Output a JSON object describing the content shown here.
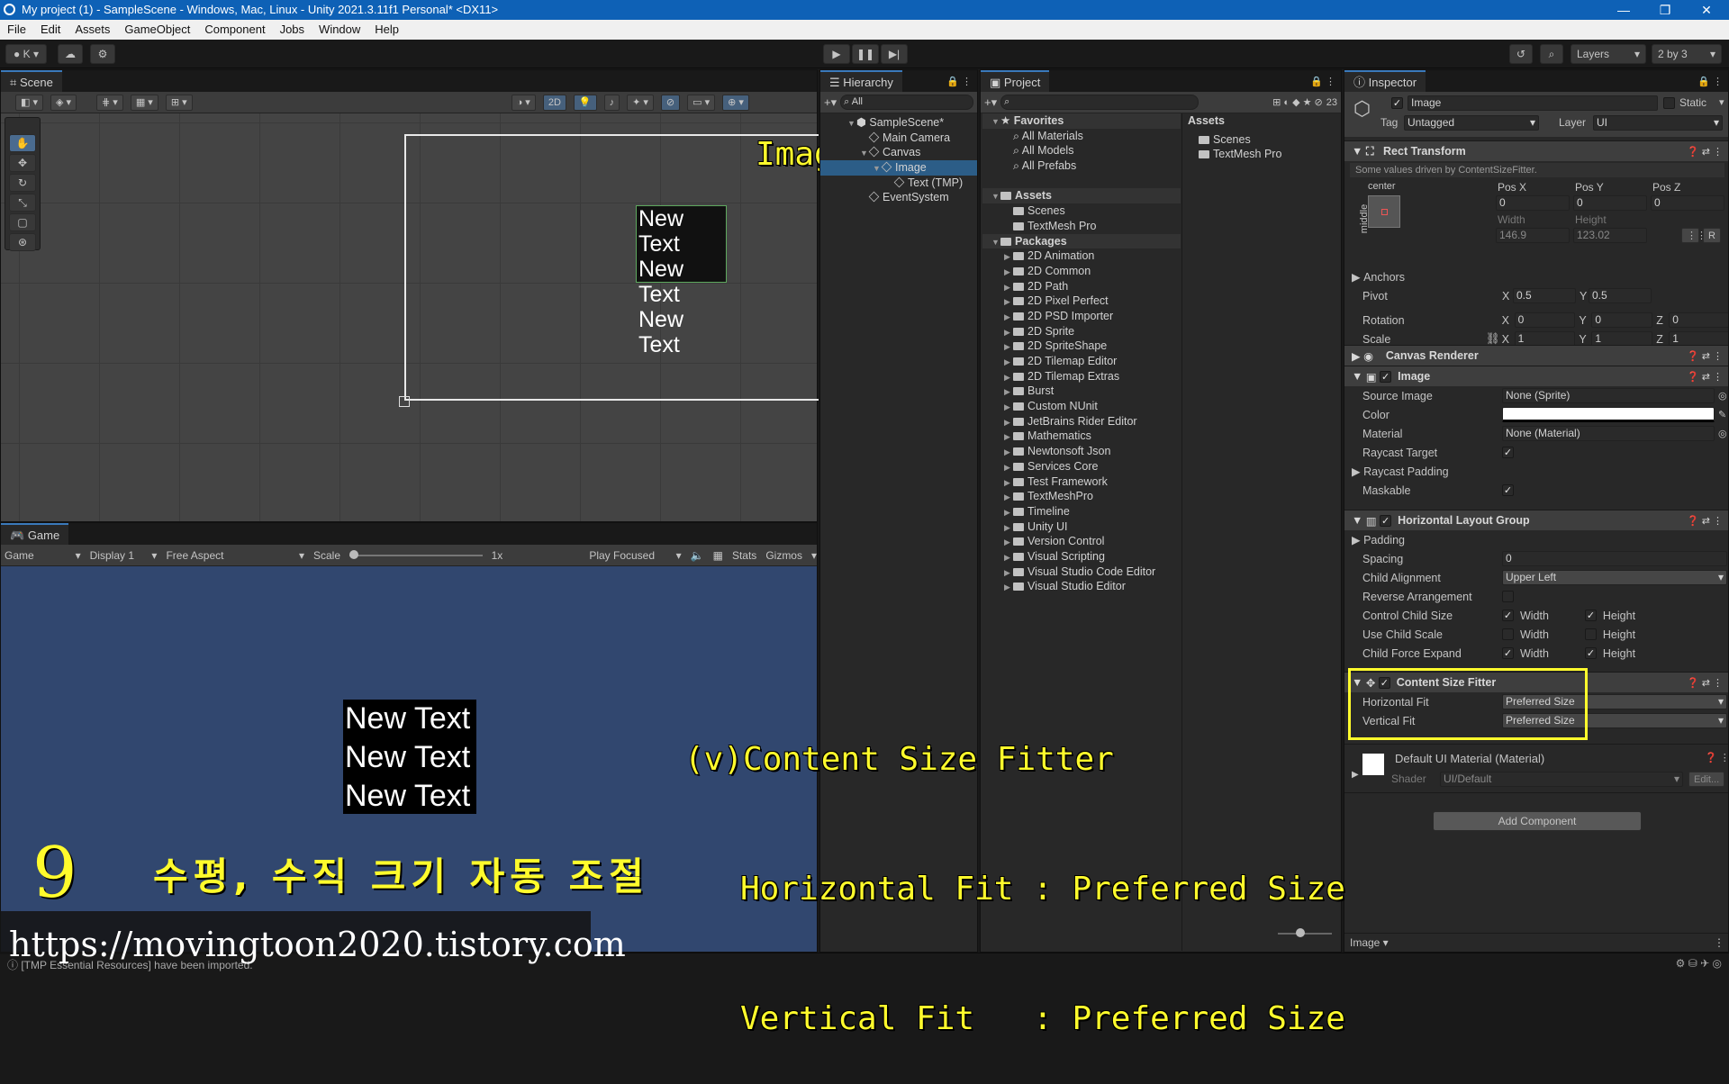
{
  "window": {
    "title": "My project (1) - SampleScene - Windows, Mac, Linux - Unity 2021.3.11f1 Personal* <DX11>",
    "min": "—",
    "max": "❐",
    "close": "✕"
  },
  "menu": [
    "File",
    "Edit",
    "Assets",
    "GameObject",
    "Component",
    "Jobs",
    "Window",
    "Help"
  ],
  "toolbar": {
    "account": "K",
    "layers": "Layers",
    "layout": "2 by 3"
  },
  "scene": {
    "tab": "Scene",
    "mode2d": "2D",
    "overlay_label": "Image",
    "texts": [
      "New Text",
      "New Text",
      "New Text"
    ]
  },
  "game": {
    "tab": "Game",
    "view": "Game",
    "display": "Display 1",
    "aspect": "Free Aspect",
    "scale_label": "Scale",
    "scale_value": "1x",
    "play": "Play Focused",
    "stats": "Stats",
    "gizmos": "Gizmos",
    "texts": [
      "New Text",
      "New Text",
      "New Text"
    ]
  },
  "hierarchy": {
    "tab": "Hierarchy",
    "search": "All",
    "items": [
      {
        "label": "SampleScene*",
        "depth": 0,
        "arrow": "▼",
        "icon": "scene"
      },
      {
        "label": "Main Camera",
        "depth": 1,
        "arrow": "",
        "icon": "go"
      },
      {
        "label": "Canvas",
        "depth": 1,
        "arrow": "▼",
        "icon": "go"
      },
      {
        "label": "Image",
        "depth": 2,
        "arrow": "▼",
        "icon": "go",
        "selected": true
      },
      {
        "label": "Text (TMP)",
        "depth": 3,
        "arrow": "",
        "icon": "go"
      },
      {
        "label": "EventSystem",
        "depth": 1,
        "arrow": "",
        "icon": "go"
      }
    ]
  },
  "project": {
    "tab": "Project",
    "badge": "23",
    "tree": [
      {
        "label": "Favorites",
        "depth": 0,
        "arrow": "▼",
        "icon": "star",
        "head": true
      },
      {
        "label": "All Materials",
        "depth": 1,
        "arrow": "",
        "icon": "search"
      },
      {
        "label": "All Models",
        "depth": 1,
        "arrow": "",
        "icon": "search"
      },
      {
        "label": "All Prefabs",
        "depth": 1,
        "arrow": "",
        "icon": "search"
      },
      {
        "label": "",
        "depth": 0,
        "arrow": "",
        "icon": ""
      },
      {
        "label": "Assets",
        "depth": 0,
        "arrow": "▼",
        "icon": "folder",
        "head": true
      },
      {
        "label": "Scenes",
        "depth": 1,
        "arrow": "",
        "icon": "folder"
      },
      {
        "label": "TextMesh Pro",
        "depth": 1,
        "arrow": "",
        "icon": "folder"
      },
      {
        "label": "Packages",
        "depth": 0,
        "arrow": "▼",
        "icon": "folder",
        "head": true
      },
      {
        "label": "2D Animation",
        "depth": 1,
        "arrow": "▶",
        "icon": "folder"
      },
      {
        "label": "2D Common",
        "depth": 1,
        "arrow": "▶",
        "icon": "folder"
      },
      {
        "label": "2D Path",
        "depth": 1,
        "arrow": "▶",
        "icon": "folder"
      },
      {
        "label": "2D Pixel Perfect",
        "depth": 1,
        "arrow": "▶",
        "icon": "folder"
      },
      {
        "label": "2D PSD Importer",
        "depth": 1,
        "arrow": "▶",
        "icon": "folder"
      },
      {
        "label": "2D Sprite",
        "depth": 1,
        "arrow": "▶",
        "icon": "folder"
      },
      {
        "label": "2D SpriteShape",
        "depth": 1,
        "arrow": "▶",
        "icon": "folder"
      },
      {
        "label": "2D Tilemap Editor",
        "depth": 1,
        "arrow": "▶",
        "icon": "folder"
      },
      {
        "label": "2D Tilemap Extras",
        "depth": 1,
        "arrow": "▶",
        "icon": "folder"
      },
      {
        "label": "Burst",
        "depth": 1,
        "arrow": "▶",
        "icon": "folder"
      },
      {
        "label": "Custom NUnit",
        "depth": 1,
        "arrow": "▶",
        "icon": "folder"
      },
      {
        "label": "JetBrains Rider Editor",
        "depth": 1,
        "arrow": "▶",
        "icon": "folder"
      },
      {
        "label": "Mathematics",
        "depth": 1,
        "arrow": "▶",
        "icon": "folder"
      },
      {
        "label": "Newtonsoft Json",
        "depth": 1,
        "arrow": "▶",
        "icon": "folder"
      },
      {
        "label": "Services Core",
        "depth": 1,
        "arrow": "▶",
        "icon": "folder"
      },
      {
        "label": "Test Framework",
        "depth": 1,
        "arrow": "▶",
        "icon": "folder"
      },
      {
        "label": "TextMeshPro",
        "depth": 1,
        "arrow": "▶",
        "icon": "folder"
      },
      {
        "label": "Timeline",
        "depth": 1,
        "arrow": "▶",
        "icon": "folder"
      },
      {
        "label": "Unity UI",
        "depth": 1,
        "arrow": "▶",
        "icon": "folder"
      },
      {
        "label": "Version Control",
        "depth": 1,
        "arrow": "▶",
        "icon": "folder"
      },
      {
        "label": "Visual Scripting",
        "depth": 1,
        "arrow": "▶",
        "icon": "folder"
      },
      {
        "label": "Visual Studio Code Editor",
        "depth": 1,
        "arrow": "▶",
        "icon": "folder"
      },
      {
        "label": "Visual Studio Editor",
        "depth": 1,
        "arrow": "▶",
        "icon": "folder"
      }
    ],
    "assets_header": "Assets",
    "assets": [
      "Scenes",
      "TextMesh Pro"
    ]
  },
  "inspector": {
    "tab": "Inspector",
    "name": "Image",
    "static": "Static",
    "tag_label": "Tag",
    "tag": "Untagged",
    "layer_label": "Layer",
    "layer": "UI",
    "rect": {
      "title": "Rect Transform",
      "note": "Some values driven by ContentSizeFitter.",
      "anchor_h": "center",
      "anchor_v": "middle",
      "posx_l": "Pos X",
      "posy_l": "Pos Y",
      "posz_l": "Pos Z",
      "posx": "0",
      "posy": "0",
      "posz": "0",
      "w_l": "Width",
      "h_l": "Height",
      "w": "146.9",
      "h": "123.02",
      "r": "R",
      "anchors": "Anchors",
      "pivot": "Pivot",
      "pivot_x": "0.5",
      "pivot_y": "0.5",
      "rotation": "Rotation",
      "rot_x": "0",
      "rot_y": "0",
      "rot_z": "0",
      "scale": "Scale",
      "sc_x": "1",
      "sc_y": "1",
      "sc_z": "1",
      "x": "X",
      "y": "Y",
      "z": "Z"
    },
    "canvas_renderer": "Canvas Renderer",
    "image": {
      "title": "Image",
      "source_l": "Source Image",
      "source": "None (Sprite)",
      "color_l": "Color",
      "material_l": "Material",
      "material": "None (Material)",
      "raycast_l": "Raycast Target",
      "padding_l": "Raycast Padding",
      "maskable_l": "Maskable"
    },
    "hlg": {
      "title": "Horizontal Layout Group",
      "padding_l": "Padding",
      "spacing_l": "Spacing",
      "spacing": "0",
      "align_l": "Child Alignment",
      "align": "Upper Left",
      "reverse_l": "Reverse Arrangement",
      "ccs_l": "Control Child Size",
      "ucs_l": "Use Child Scale",
      "cfe_l": "Child Force Expand",
      "width": "Width",
      "height": "Height"
    },
    "csf": {
      "title": "Content Size Fitter",
      "hfit_l": "Horizontal Fit",
      "hfit": "Preferred Size",
      "vfit_l": "Vertical Fit",
      "vfit": "Preferred Size"
    },
    "material": {
      "name": "Default UI Material (Material)",
      "shader_l": "Shader",
      "shader": "UI/Default",
      "edit": "Edit..."
    },
    "add_component": "Add Component",
    "footer": "Image ▾"
  },
  "overlay": {
    "line1": "(v)Content Size Fitter",
    "line2": "Horizontal Fit : Preferred Size",
    "line3": "Vertical Fit   : Preferred Size",
    "step": "9",
    "korean": "수평, 수직 크기 자동 조절",
    "url": "https://movingtoon2020.tistory.com"
  },
  "status": {
    "message": "[TMP Essential Resources] have been imported."
  },
  "colors": {
    "accent": "#0e61b6",
    "selection": "#2c5d87",
    "highlight": "#fffb2c",
    "game_bg": "#31476f"
  }
}
